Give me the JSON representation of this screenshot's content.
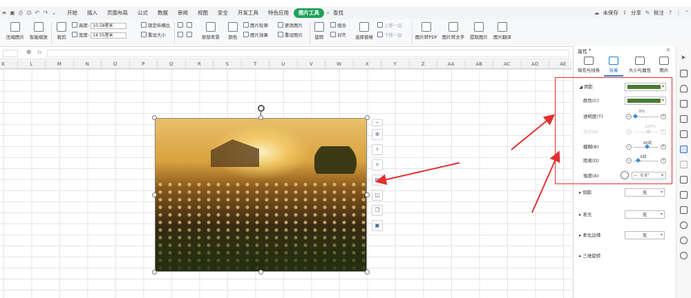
{
  "menubar": {
    "tabs": [
      "开始",
      "插入",
      "页面布局",
      "公式",
      "数据",
      "审阅",
      "视图",
      "安全",
      "开发工具",
      "特色应用",
      "图片工具",
      "查找"
    ],
    "active_tab": "图片工具",
    "right": {
      "unsaved": "未保存",
      "share": "分享",
      "comment": "批注"
    }
  },
  "ribbon": {
    "compress": "压缩图片",
    "smart_zoom": "智能缩放",
    "crop": "裁剪",
    "height_label": "高度:",
    "height_value": "10.58厘米",
    "width_label": "宽度:",
    "width_value": "14.55厘米",
    "lock_ratio": "锁定纵横比",
    "reset_size": "重设大小",
    "remove_bg": "抠除背景",
    "color": "颜色",
    "outline": "图片轮廓",
    "effect": "图片效果",
    "change_pic": "更改图片",
    "reset_pic": "重设图片",
    "rotate": "旋转",
    "group": "组合",
    "align": "对齐",
    "select_pane": "选择窗格",
    "bring_forward": "上移一层",
    "send_backward": "下移一层",
    "to_pdf": "图片转PDF",
    "to_text": "图片转文字",
    "extract": "提取图片",
    "translate": "图片翻译"
  },
  "formula_bar": {
    "fx": "fx"
  },
  "columns": [
    "K",
    "L",
    "M",
    "N",
    "O",
    "P",
    "Q",
    "R",
    "S",
    "T",
    "U",
    "V",
    "W",
    "X",
    "Y",
    "Z",
    "AA",
    "AB",
    "AC",
    "AD",
    "AE"
  ],
  "panel": {
    "title": "属性",
    "tabs": [
      "填充与线条",
      "效果",
      "大小与属性",
      "图片"
    ],
    "active_tab": "效果",
    "shadow": "阴影",
    "color": "颜色(C)",
    "transparency": "透明度(T)",
    "transparency_val": "0%",
    "size": "大小(S)",
    "size_val": "100%",
    "blur": "模糊(B)",
    "blur_val": "48磅",
    "distance": "距离(D)",
    "distance_val": "6磅",
    "angle": "角度(A)",
    "angle_val": "0.0°",
    "reflection": "倒影",
    "glow": "发光",
    "soft_edge": "柔化边缘",
    "none": "无",
    "three_d": "三维旋转"
  },
  "colors": {
    "shadow_green": "#4a7b32",
    "accent_green": "#1fa35b",
    "highlight_red": "#e23030"
  }
}
